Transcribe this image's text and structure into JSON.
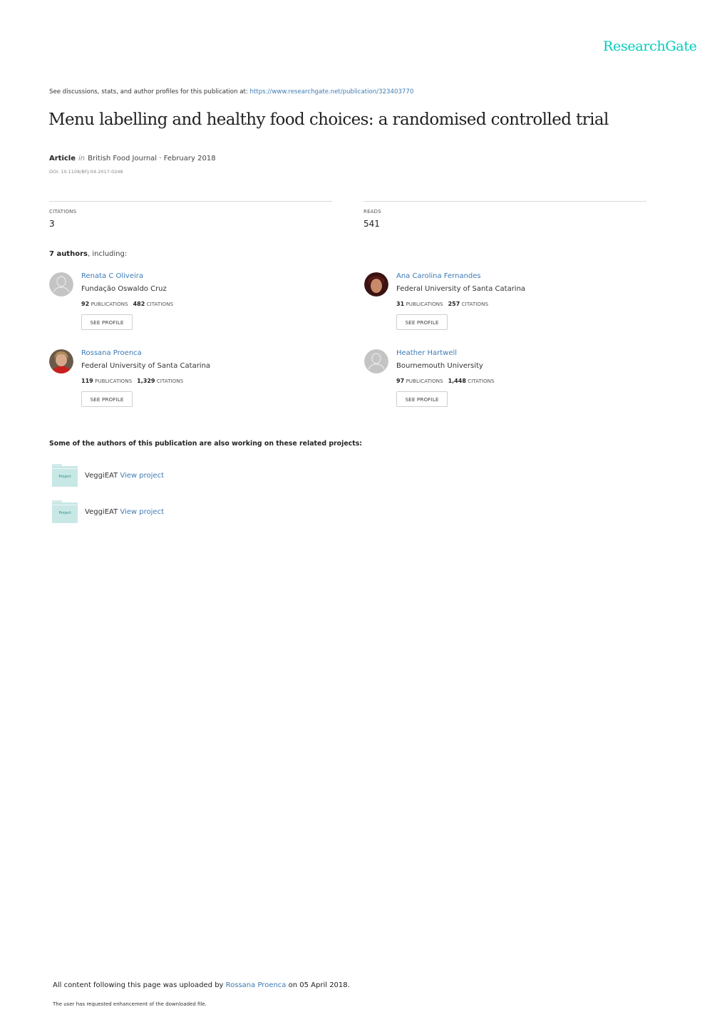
{
  "brand": {
    "logo_text": "ResearchGate",
    "accent_color": "#00ccbb",
    "link_color": "#3e7bb4"
  },
  "header": {
    "see_text": "See discussions, stats, and author profiles for this publication at: ",
    "publication_url": "https://www.researchgate.net/publication/323403770"
  },
  "publication": {
    "title": "Menu labelling and healthy food choices: a randomised controlled trial",
    "type": "Article",
    "in_word": "in",
    "journal_date": "British Food Journal · February 2018",
    "doi": "DOI: 10.1108/BFJ-04-2017-0248"
  },
  "stats": {
    "citations_label": "CITATIONS",
    "citations_value": "3",
    "reads_label": "READS",
    "reads_value": "541"
  },
  "authors_section": {
    "count_text": "7 authors",
    "suffix": ", including:",
    "publications_label": "PUBLICATIONS",
    "citations_label": "CITATIONS",
    "see_profile_label": "SEE PROFILE",
    "authors": [
      {
        "name": "Renata C Oliveira",
        "institution": "Fundação Oswaldo Cruz",
        "publications": "92",
        "citations": "482",
        "avatar": "placeholder"
      },
      {
        "name": "Ana Carolina Fernandes",
        "institution": "Federal University of Santa Catarina",
        "publications": "31",
        "citations": "257",
        "avatar": "photo"
      },
      {
        "name": "Rossana Proenca",
        "institution": "Federal University of Santa Catarina",
        "publications": "119",
        "citations": "1,329",
        "avatar": "photo"
      },
      {
        "name": "Heather Hartwell",
        "institution": "Bournemouth University",
        "publications": "97",
        "citations": "1,448",
        "avatar": "placeholder"
      }
    ]
  },
  "projects_section": {
    "heading": "Some of the authors of this publication are also working on these related projects:",
    "folder_label": "Project",
    "view_label": "View project",
    "projects": [
      {
        "name": "VeggiEAT"
      },
      {
        "name": "VeggiEAT"
      }
    ]
  },
  "footer": {
    "uploaded_prefix": "All content following this page was uploaded by ",
    "uploader": "Rossana Proenca",
    "uploaded_suffix": " on 05 April 2018.",
    "enhancement_note": "The user has requested enhancement of the downloaded file."
  }
}
